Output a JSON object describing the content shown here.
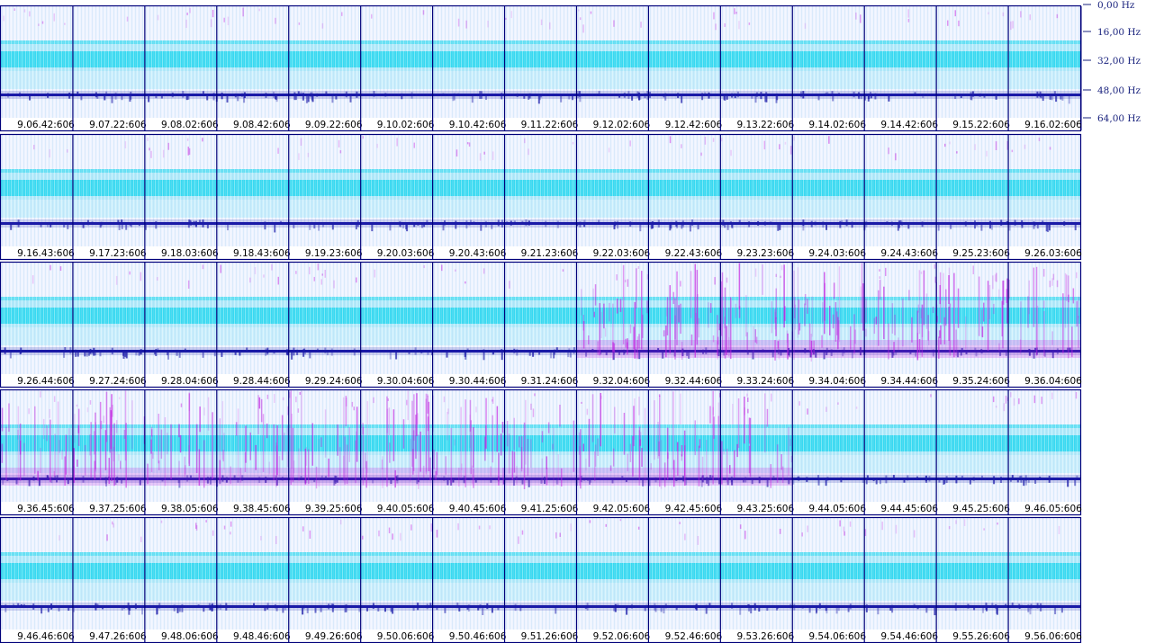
{
  "chart_data": {
    "type": "heatmap",
    "description_axis": "frequency",
    "frequency_ticks": [
      "0,00 Hz",
      "16,00 Hz",
      "32,00 Hz",
      "48,00 Hz",
      "64,00 Hz"
    ],
    "frequency_range": [
      0,
      64
    ],
    "rows": [
      {
        "labels": [
          "9.06.42:606",
          "9.07.22:606",
          "9.08.02:606",
          "9.08.42:606",
          "9.09.22:606",
          "9.10.02:606",
          "9.10.42:606",
          "9.11.22:606",
          "9.12.02:606",
          "9.12.42:606",
          "9.13.22:606",
          "9.14.02:606",
          "9.14.42:606",
          "9.15.22:606",
          "9.16.02:606"
        ],
        "bursts": []
      },
      {
        "labels": [
          "9.16.43:606",
          "9.17.23:606",
          "9.18.03:606",
          "9.18.43:606",
          "9.19.23:606",
          "9.20.03:606",
          "9.20.43:606",
          "9.21.23:606",
          "9.22.03:606",
          "9.22.43:606",
          "9.23.23:606",
          "9.24.03:606",
          "9.24.43:606",
          "9.25.23:606",
          "9.26.03:606"
        ],
        "bursts": []
      },
      {
        "labels": [
          "9.26.44:606",
          "9.27.24:606",
          "9.28.04:606",
          "9.28.44:606",
          "9.29.24:606",
          "9.30.04:606",
          "9.30.44:606",
          "9.31.24:606",
          "9.32.04:606",
          "9.32.44:606",
          "9.33.24:606",
          "9.34.04:606",
          "9.34.44:606",
          "9.35.24:606",
          "9.36.04:606"
        ],
        "bursts": [
          8,
          9,
          10,
          11,
          12,
          13,
          14
        ]
      },
      {
        "labels": [
          "9.36.45:606",
          "9.37.25:606",
          "9.38.05:606",
          "9.38.45:606",
          "9.39.25:606",
          "9.40.05:606",
          "9.40.45:606",
          "9.41.25:606",
          "9.42.05:606",
          "9.42.45:606",
          "9.43.25:606",
          "9.44.05:606",
          "9.44.45:606",
          "9.45.25:606",
          "9.46.05:606"
        ],
        "bursts": [
          0,
          1,
          2,
          3,
          4,
          5,
          6,
          7,
          8,
          9,
          10
        ]
      },
      {
        "labels": [
          "9.46.46:606",
          "9.47.26:606",
          "9.48.06:606",
          "9.48.46:606",
          "9.49.26:606",
          "9.50.06:606",
          "9.50.46:606",
          "9.51.26:606",
          "9.52.06:606",
          "9.52.46:606",
          "9.53.26:606",
          "9.54.06:606",
          "9.54.46:606",
          "9.55.26:606",
          "9.56.06:606"
        ],
        "bursts": []
      }
    ],
    "colors": {
      "background": "#eef3ff",
      "band": "#22d8ee",
      "line": "#1a1aa8",
      "burst": "#c020e0",
      "border": "#00007a"
    }
  }
}
